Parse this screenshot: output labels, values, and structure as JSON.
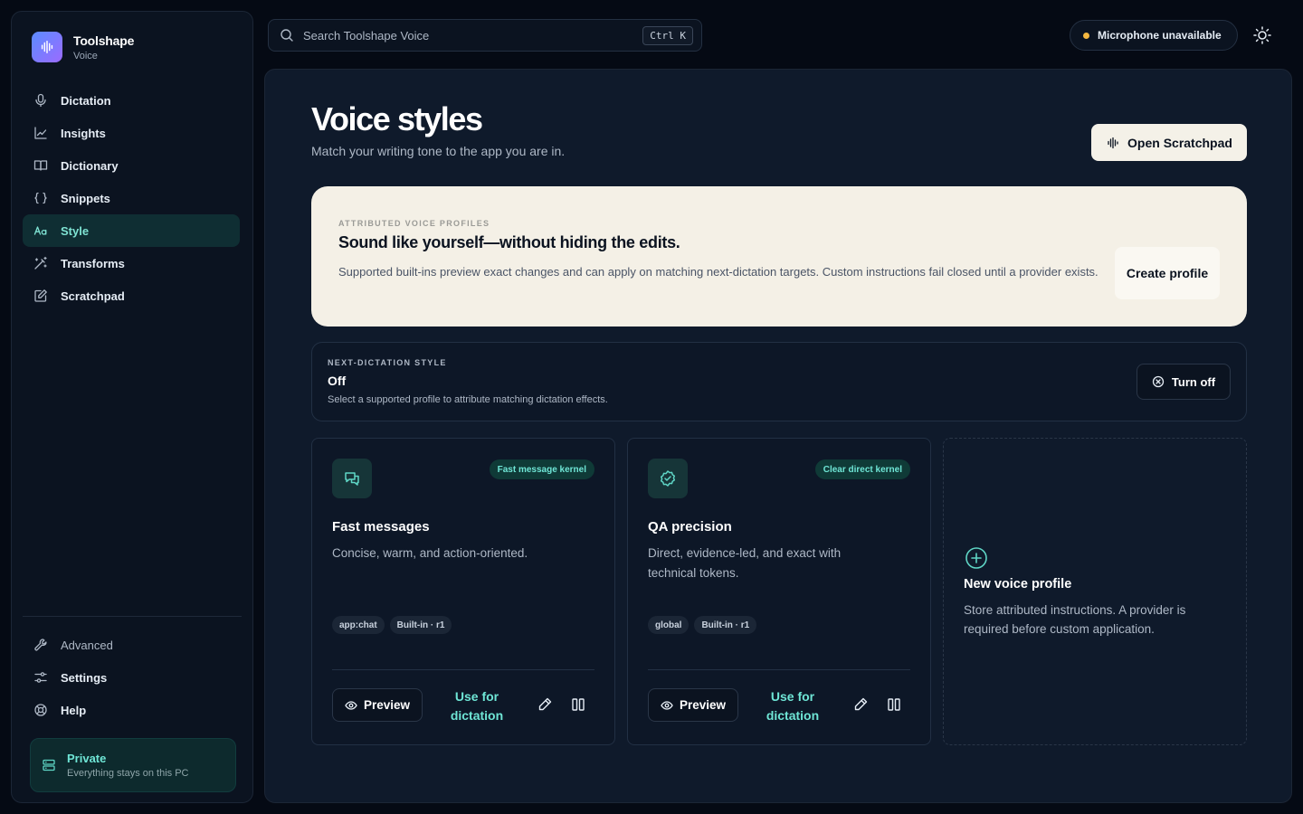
{
  "brand": {
    "name": "Toolshape",
    "sub": "Voice"
  },
  "sidebar": {
    "items": [
      {
        "label": "Dictation",
        "icon": "mic-icon"
      },
      {
        "label": "Insights",
        "icon": "chart-line-icon"
      },
      {
        "label": "Dictionary",
        "icon": "book-icon"
      },
      {
        "label": "Snippets",
        "icon": "braces-icon"
      },
      {
        "label": "Style",
        "icon": "text-style-icon",
        "active": true
      },
      {
        "label": "Transforms",
        "icon": "magic-wand-icon"
      },
      {
        "label": "Scratchpad",
        "icon": "edit-square-icon"
      }
    ],
    "bottom": [
      {
        "label": "Advanced",
        "icon": "wrench-icon"
      },
      {
        "label": "Settings",
        "icon": "sliders-icon"
      },
      {
        "label": "Help",
        "icon": "lifebuoy-icon"
      }
    ],
    "privacy": {
      "title": "Private",
      "subtitle": "Everything stays on this PC",
      "icon": "server-icon"
    }
  },
  "search": {
    "placeholder": "Search Toolshape Voice",
    "shortcut": "Ctrl K"
  },
  "status": {
    "mic_label": "Microphone unavailable",
    "dot_color": "#f4b740"
  },
  "page": {
    "title": "Voice styles",
    "subtitle": "Match your writing tone to the app you are in.",
    "open_scratchpad": "Open Scratchpad"
  },
  "banner": {
    "eyebrow": "ATTRIBUTED VOICE PROFILES",
    "title": "Sound like yourself—without hiding the edits.",
    "description": "Supported built-ins preview exact changes and can apply on matching next-dictation targets. Custom instructions fail closed until a provider exists.",
    "create_label": "Create profile"
  },
  "next_style": {
    "eyebrow": "NEXT-DICTATION STYLE",
    "value": "Off",
    "description": "Select a supported profile to attribute matching dictation effects.",
    "turn_off_label": "Turn off"
  },
  "cards": [
    {
      "title": "Fast messages",
      "badge": "Fast message kernel",
      "description": "Concise, warm, and action-oriented.",
      "tags": [
        "app:chat",
        "Built-in · r1"
      ],
      "preview_label": "Preview",
      "use_label": "Use for dictation",
      "icon": "chat-bubbles-icon"
    },
    {
      "title": "QA precision",
      "badge": "Clear direct kernel",
      "description": "Direct, evidence-led, and exact with technical tokens.",
      "tags": [
        "global",
        "Built-in · r1"
      ],
      "preview_label": "Preview",
      "use_label": "Use for dictation",
      "icon": "badge-check-icon"
    }
  ],
  "new_profile": {
    "title": "New voice profile",
    "description": "Store attributed instructions. A provider is required before custom application."
  },
  "colors": {
    "accent": "#6fe6d6",
    "background": "#050a14",
    "panel": "#0f1a2b",
    "banner": "#f4f0e6"
  }
}
